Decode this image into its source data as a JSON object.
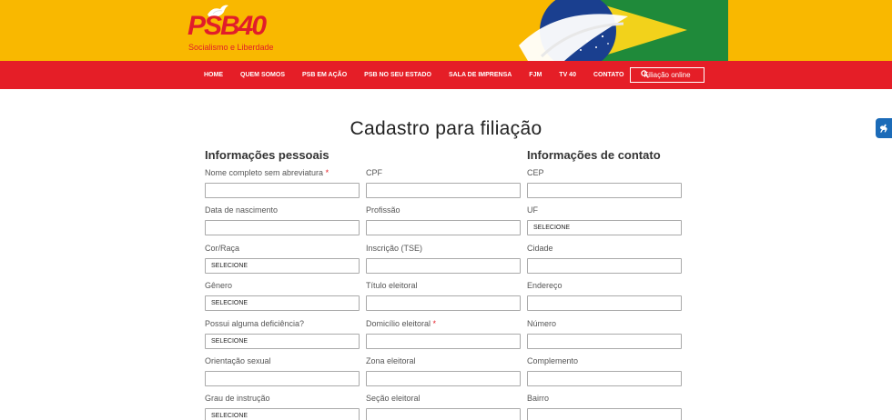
{
  "brand": {
    "logo_text": "PSB40",
    "tagline": "Socialismo e Liberdade"
  },
  "nav": {
    "items": [
      "HOME",
      "QUEM SOMOS",
      "PSB EM AÇÃO",
      "PSB NO SEU ESTADO",
      "SALA DE IMPRENSA",
      "FJM",
      "TV 40",
      "CONTATO"
    ],
    "cta": "Filiação online"
  },
  "page": {
    "title": "Cadastro para filiação"
  },
  "sections": {
    "personal": "Informações pessoais",
    "contact": "Informações de contato"
  },
  "form": {
    "col1": [
      {
        "label": "Nome completo sem abreviatura",
        "required": "*",
        "value": ""
      },
      {
        "label": "Data de nascimento",
        "value": ""
      },
      {
        "label": "Cor/Raça",
        "value": "SELECIONE"
      },
      {
        "label": "Gênero",
        "value": "SELECIONE"
      },
      {
        "label": "Possui alguma deficiência?",
        "value": "SELECIONE"
      },
      {
        "label": "Orientação sexual",
        "value": ""
      },
      {
        "label": "Grau de instrução",
        "value": "SELECIONE"
      }
    ],
    "col2": [
      {
        "label": "CPF",
        "value": ""
      },
      {
        "label": "Profissão",
        "value": ""
      },
      {
        "label": "Inscrição (TSE)",
        "value": ""
      },
      {
        "label": "Título eleitoral",
        "value": ""
      },
      {
        "label": "Domicílio eleitoral",
        "required": "*",
        "value": ""
      },
      {
        "label": "Zona eleitoral",
        "value": ""
      },
      {
        "label": "Seção eleitoral",
        "value": ""
      }
    ],
    "col3": [
      {
        "label": "CEP",
        "value": ""
      },
      {
        "label": "UF",
        "value": "SELECIONE"
      },
      {
        "label": "Cidade",
        "value": ""
      },
      {
        "label": "Endereço",
        "value": ""
      },
      {
        "label": "Número",
        "value": ""
      },
      {
        "label": "Complemento",
        "value": ""
      },
      {
        "label": "Bairro",
        "value": ""
      }
    ]
  },
  "colors": {
    "banner": "#f9b800",
    "nav": "#e51e27",
    "accent_blue": "#1b6bb8"
  },
  "icons": {
    "search": "search-icon",
    "accessibility": "accessibility-icon"
  }
}
